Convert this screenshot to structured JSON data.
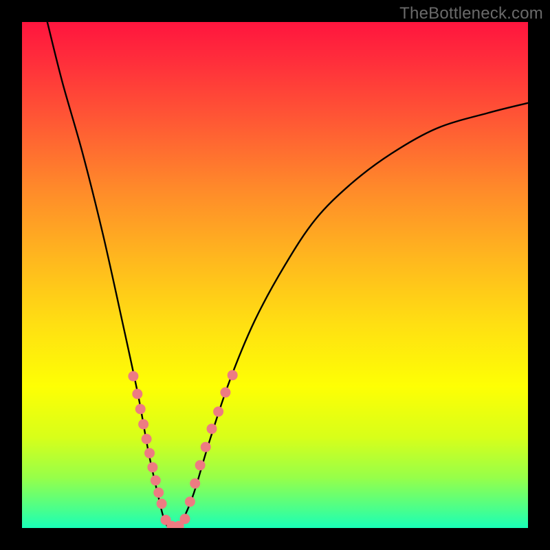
{
  "watermark": "TheBottleneck.com",
  "chart_data": {
    "type": "line",
    "title": "",
    "xlabel": "",
    "ylabel": "",
    "xlim": [
      0,
      100
    ],
    "ylim": [
      0,
      100
    ],
    "series": [
      {
        "name": "bottleneck-curve",
        "x": [
          5,
          8,
          12,
          16,
          20,
          23,
          25,
          27,
          28,
          29,
          30,
          31,
          32,
          34,
          37,
          41,
          46,
          52,
          58,
          65,
          73,
          82,
          92,
          100
        ],
        "y": [
          100,
          88,
          74,
          58,
          40,
          26,
          15,
          6,
          2,
          0,
          0,
          0,
          2,
          7,
          17,
          29,
          41,
          52,
          61,
          68,
          74,
          79,
          82,
          84
        ]
      }
    ],
    "markers": [
      {
        "name": "left-cluster",
        "color": "#ed7b82",
        "points": [
          {
            "x": 22.0,
            "y": 30.0
          },
          {
            "x": 22.8,
            "y": 26.5
          },
          {
            "x": 23.4,
            "y": 23.5
          },
          {
            "x": 24.0,
            "y": 20.5
          },
          {
            "x": 24.6,
            "y": 17.6
          },
          {
            "x": 25.2,
            "y": 14.8
          },
          {
            "x": 25.8,
            "y": 12.0
          },
          {
            "x": 26.4,
            "y": 9.4
          },
          {
            "x": 27.0,
            "y": 7.0
          },
          {
            "x": 27.6,
            "y": 4.8
          }
        ]
      },
      {
        "name": "bottom-cluster",
        "color": "#ed7b82",
        "points": [
          {
            "x": 28.4,
            "y": 1.6
          },
          {
            "x": 29.6,
            "y": 0.4
          },
          {
            "x": 31.0,
            "y": 0.4
          },
          {
            "x": 32.2,
            "y": 1.8
          }
        ]
      },
      {
        "name": "right-cluster",
        "color": "#ed7b82",
        "points": [
          {
            "x": 33.2,
            "y": 5.2
          },
          {
            "x": 34.2,
            "y": 8.8
          },
          {
            "x": 35.2,
            "y": 12.4
          },
          {
            "x": 36.3,
            "y": 16.0
          },
          {
            "x": 37.5,
            "y": 19.6
          },
          {
            "x": 38.8,
            "y": 23.0
          },
          {
            "x": 40.2,
            "y": 26.8
          },
          {
            "x": 41.6,
            "y": 30.2
          }
        ]
      }
    ],
    "gradient_stops": [
      {
        "offset": 0,
        "color": "#ff153e"
      },
      {
        "offset": 8,
        "color": "#ff2f3b"
      },
      {
        "offset": 20,
        "color": "#ff5a34"
      },
      {
        "offset": 33,
        "color": "#ff8a2a"
      },
      {
        "offset": 47,
        "color": "#ffb81e"
      },
      {
        "offset": 60,
        "color": "#ffe012"
      },
      {
        "offset": 72,
        "color": "#feff04"
      },
      {
        "offset": 82,
        "color": "#d8ff19"
      },
      {
        "offset": 90,
        "color": "#97ff49"
      },
      {
        "offset": 96,
        "color": "#4dff89"
      },
      {
        "offset": 100,
        "color": "#19ffb7"
      }
    ]
  }
}
